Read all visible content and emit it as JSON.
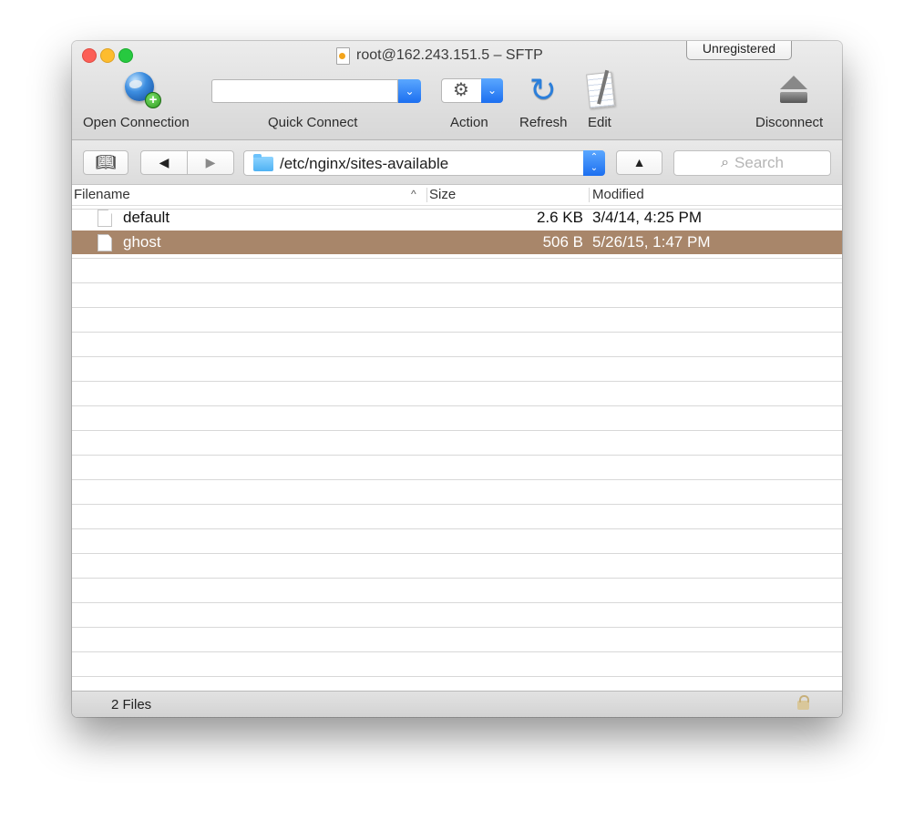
{
  "window": {
    "title": "root@162.243.151.5 – SFTP",
    "unregistered_label": "Unregistered"
  },
  "toolbar": {
    "open_connection_label": "Open Connection",
    "quick_connect_label": "Quick Connect",
    "quick_connect_value": "",
    "action_label": "Action",
    "refresh_label": "Refresh",
    "edit_label": "Edit",
    "disconnect_label": "Disconnect"
  },
  "navigation": {
    "bookmarks_icon": "bookmarks-icon",
    "back_symbol": "◀",
    "forward_symbol": "▶",
    "path": "/etc/nginx/sites-available",
    "up_symbol": "▲",
    "search_placeholder": "Search"
  },
  "table": {
    "columns": [
      "Filename",
      "Size",
      "Modified"
    ],
    "rows": [
      {
        "name": "default",
        "size": "2.6 KB",
        "modified": "3/4/14, 4:25 PM",
        "selected": false
      },
      {
        "name": "ghost",
        "size": "506 B",
        "modified": "5/26/15, 1:47 PM",
        "selected": true
      }
    ]
  },
  "statusbar": {
    "text": "2 Files"
  },
  "colors": {
    "selection": "#a8866a",
    "accent": "#1c6ff0",
    "close": "#fc5f57",
    "minimize": "#fdbc2e",
    "zoom": "#27c940"
  }
}
